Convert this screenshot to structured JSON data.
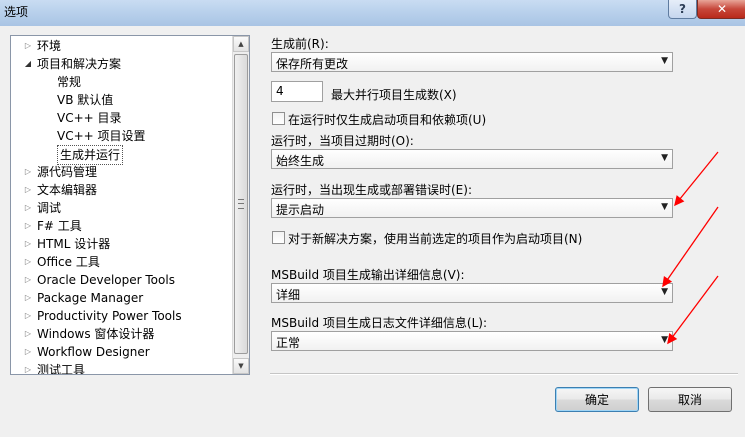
{
  "window": {
    "title": "选项",
    "help_label": "?",
    "close_label": "✕"
  },
  "tree": {
    "items": [
      {
        "label": "环境",
        "expander": "▷"
      },
      {
        "label": "项目和解决方案",
        "expander": "◢"
      },
      {
        "label": "常规",
        "expander": ""
      },
      {
        "label": "VB 默认值",
        "expander": ""
      },
      {
        "label": "VC++ 目录",
        "expander": ""
      },
      {
        "label": "VC++ 项目设置",
        "expander": ""
      },
      {
        "label": "生成并运行",
        "expander": "",
        "selected": true
      },
      {
        "label": "源代码管理",
        "expander": "▷"
      },
      {
        "label": "文本编辑器",
        "expander": "▷"
      },
      {
        "label": "调试",
        "expander": "▷"
      },
      {
        "label": "F# 工具",
        "expander": "▷"
      },
      {
        "label": "HTML 设计器",
        "expander": "▷"
      },
      {
        "label": "Office 工具",
        "expander": "▷"
      },
      {
        "label": "Oracle Developer Tools",
        "expander": "▷"
      },
      {
        "label": "Package Manager",
        "expander": "▷"
      },
      {
        "label": "Productivity Power Tools",
        "expander": "▷"
      },
      {
        "label": "Windows 窗体设计器",
        "expander": "▷"
      },
      {
        "label": "Workflow Designer",
        "expander": "▷"
      },
      {
        "label": "测试工具",
        "expander": "▷"
      }
    ],
    "scroll_up": "▲",
    "scroll_down": "▼"
  },
  "form": {
    "before_build_label": "生成前(R):",
    "before_build_value": "保存所有更改",
    "parallel_value": "4",
    "parallel_label": "最大并行项目生成数(X)",
    "only_startup_label": "在运行时仅生成启动项目和依赖项(U)",
    "out_of_date_label": "运行时，当项目过期时(O):",
    "out_of_date_value": "始终生成",
    "build_error_label": "运行时，当出现生成或部署错误时(E):",
    "build_error_value": "提示启动",
    "new_solution_label": "对于新解决方案，使用当前选定的项目作为启动项目(N)",
    "output_verbosity_label": "MSBuild 项目生成输出详细信息(V):",
    "output_verbosity_value": "详细",
    "log_verbosity_label": "MSBuild 项目生成日志文件详细信息(L):",
    "log_verbosity_value": "正常",
    "dropdown_arrow": "▼"
  },
  "buttons": {
    "ok": "确定",
    "cancel": "取消"
  },
  "annotation_color": "#ff0000"
}
